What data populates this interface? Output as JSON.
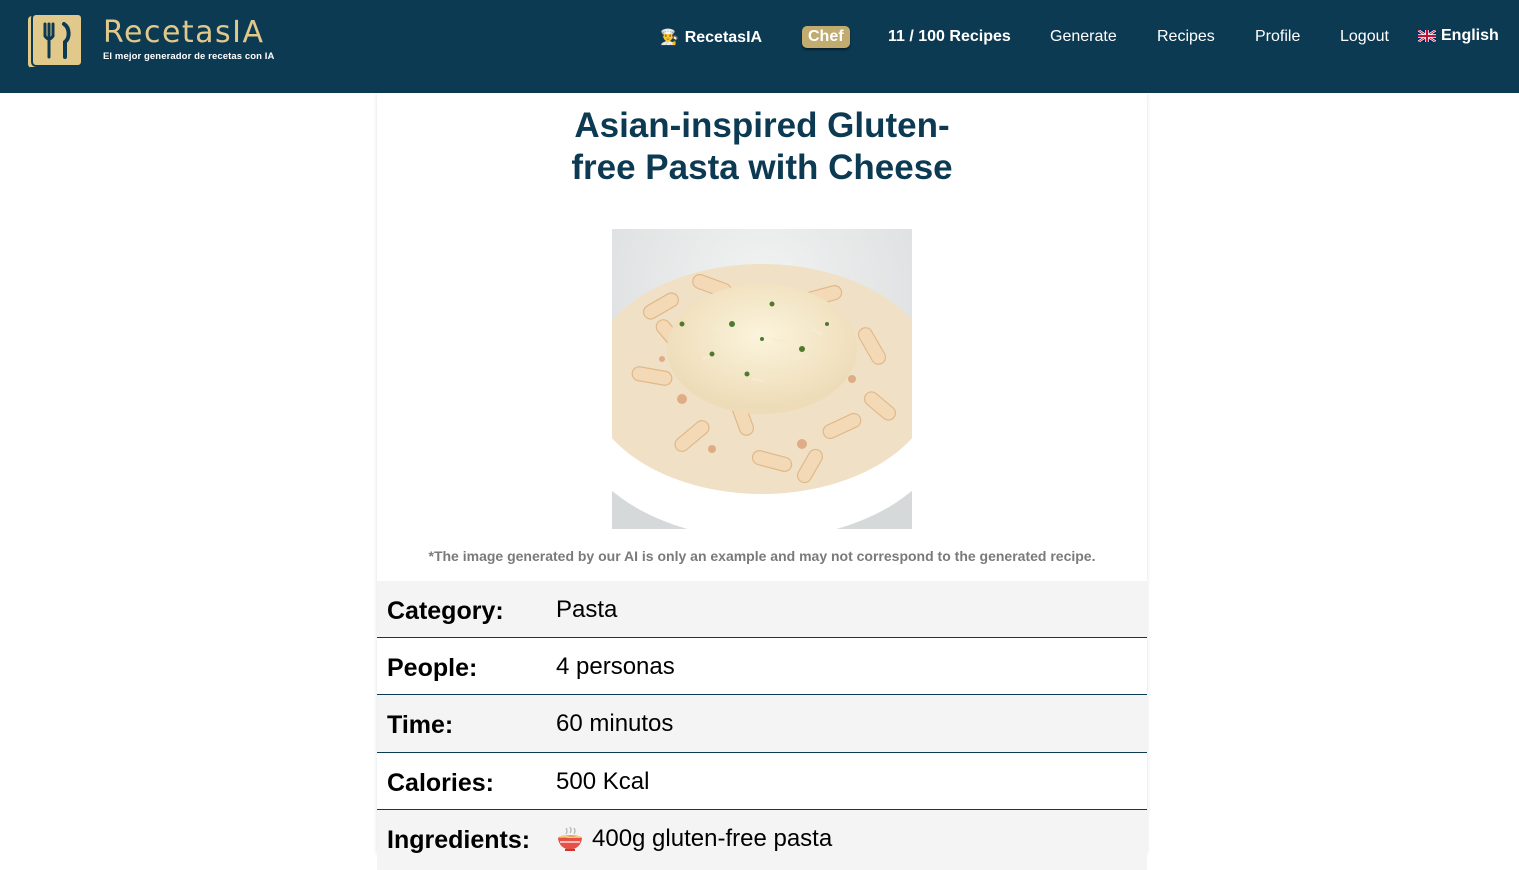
{
  "header": {
    "logo": {
      "title": "RecetasIA",
      "subtitle": "El mejor generador de recetas con IA",
      "icon": "fork-knife-book-icon"
    },
    "brand": {
      "icon": "chef-emoji-icon",
      "label": "RecetasIA"
    },
    "plan_badge": "Chef",
    "recipe_count": "11 / 100 Recipes",
    "nav": {
      "generate": "Generate",
      "recipes": "Recipes",
      "profile": "Profile",
      "logout": "Logout"
    },
    "language": {
      "icon": "uk-flag-icon",
      "label": "English"
    }
  },
  "recipe": {
    "title_line1": "Asian-inspired Gluten-",
    "title_line2": "free Pasta with Cheese",
    "image_icon": "pasta-photo",
    "disclaimer": "*The image generated by our AI is only an example and may not correspond to the generated recipe.",
    "details": [
      {
        "label": "Category:",
        "value": "Pasta"
      },
      {
        "label": "People:",
        "value": "4 personas"
      },
      {
        "label": "Time:",
        "value": "60 minutos"
      },
      {
        "label": "Calories:",
        "value": "500 Kcal"
      },
      {
        "label": "Ingredients:",
        "value": "400g gluten-free pasta",
        "icon": "noodle-bowl-icon"
      }
    ]
  },
  "colors": {
    "header_bg": "#0c3a53",
    "brand_gold": "#c2ab6e",
    "title": "#0c3a53",
    "row_shade": "#f4f4f4"
  }
}
